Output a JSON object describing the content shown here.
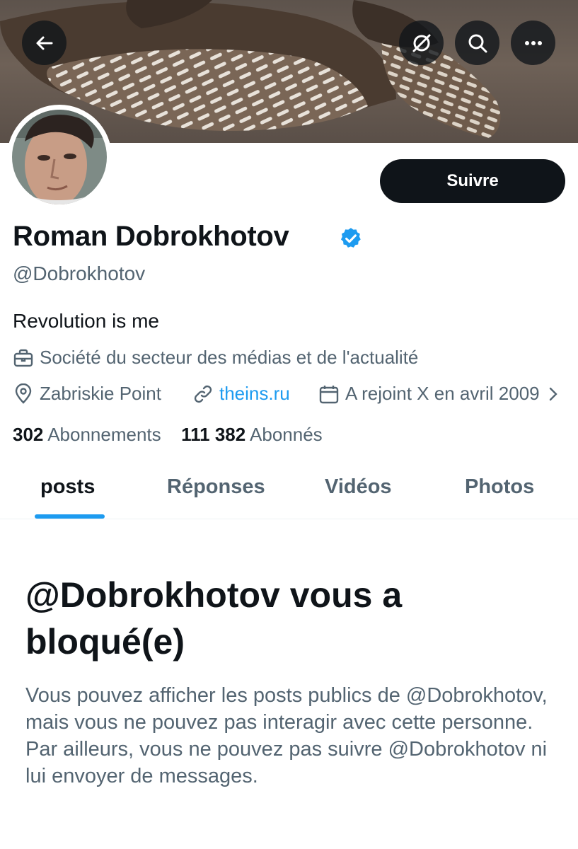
{
  "colors": {
    "accent": "#1d9bf0",
    "text": "#0f1419",
    "secondary": "#536471",
    "button_bg": "#0f1419"
  },
  "header": {
    "back_icon": "arrow-left-icon",
    "grok_icon": "grok-slash-icon",
    "search_icon": "search-icon",
    "more_icon": "more-dots-icon"
  },
  "profile": {
    "follow_label": "Suivre",
    "name": "Roman Dobrokhotov",
    "verified_icon": "verified-badge-icon",
    "handle": "@Dobrokhotov",
    "bio": "Revolution is me",
    "category": "Société du secteur des médias et de l'actualité",
    "location": "Zabriskie Point",
    "website": "theins.ru",
    "joined": "A rejoint X en avril 2009"
  },
  "stats": {
    "following_count": "302",
    "following_label": "Abonnements",
    "followers_count": "111 382",
    "followers_label": "Abonnés"
  },
  "tabs": [
    {
      "label": "posts",
      "active": true
    },
    {
      "label": "Réponses",
      "active": false
    },
    {
      "label": "Vidéos",
      "active": false
    },
    {
      "label": "Photos",
      "active": false
    }
  ],
  "blocked": {
    "title": "@Dobrokhotov vous a bloqué(e)",
    "text": "Vous pouvez afficher les posts publics de @Dobrokhotov, mais vous ne pouvez pas interagir avec cette personne. Par ailleurs, vous ne pouvez pas suivre @Dobrokhotov ni lui envoyer de messages."
  }
}
